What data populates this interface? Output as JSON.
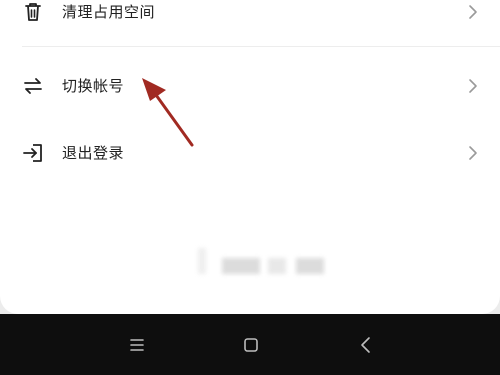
{
  "menu": {
    "items": [
      {
        "label": "清理占用空间",
        "icon": "trash-icon"
      },
      {
        "label": "切换帐号",
        "icon": "swap-icon"
      },
      {
        "label": "退出登录",
        "icon": "logout-icon"
      }
    ]
  },
  "navigation_bar": {
    "buttons": [
      "menu-icon",
      "home-icon",
      "back-icon"
    ]
  },
  "colors": {
    "annotation_arrow": "#a12a22",
    "text": "#222222",
    "chevron": "#9a9a9a",
    "nav_background": "#0e0e0e"
  }
}
